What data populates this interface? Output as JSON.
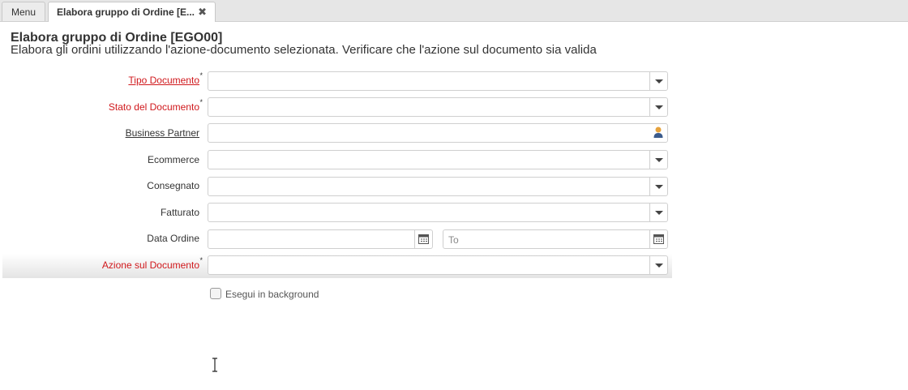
{
  "tabs": {
    "menu_label": "Menu",
    "active_label": "Elabora gruppo di Ordine [E...",
    "close_glyph": "✖"
  },
  "header": {
    "title": "Elabora gruppo di Ordine [EGO00]",
    "description": "Elabora gli ordini utilizzando l'azione-documento selezionata. Verificare che l'azione sul documento sia valida"
  },
  "form": {
    "required_marker": "*",
    "fields": [
      {
        "label": "Tipo Documento",
        "mandatory": true,
        "value": ""
      },
      {
        "label": "Stato del Documento",
        "mandatory": true,
        "value": ""
      },
      {
        "label": "Business Partner",
        "mandatory": false,
        "value": ""
      },
      {
        "label": "Ecommerce",
        "mandatory": false,
        "value": ""
      },
      {
        "label": "Consegnato",
        "mandatory": false,
        "value": ""
      },
      {
        "label": "Fatturato",
        "mandatory": false,
        "value": ""
      },
      {
        "label": "Data Ordine",
        "mandatory": false,
        "value_from": "",
        "value_to": "",
        "to_placeholder": "To"
      },
      {
        "label": "Azione sul Documento",
        "mandatory": true,
        "value": ""
      }
    ],
    "background_checkbox": {
      "label": "Esegui in background",
      "checked": false
    }
  },
  "colors": {
    "mandatory_label": "#d0181c",
    "tab_bar": "#e6e6e6"
  },
  "icons": [
    "caret-down-icon",
    "calendar-icon",
    "business-partner-icon",
    "close-icon",
    "text-cursor-icon"
  ]
}
